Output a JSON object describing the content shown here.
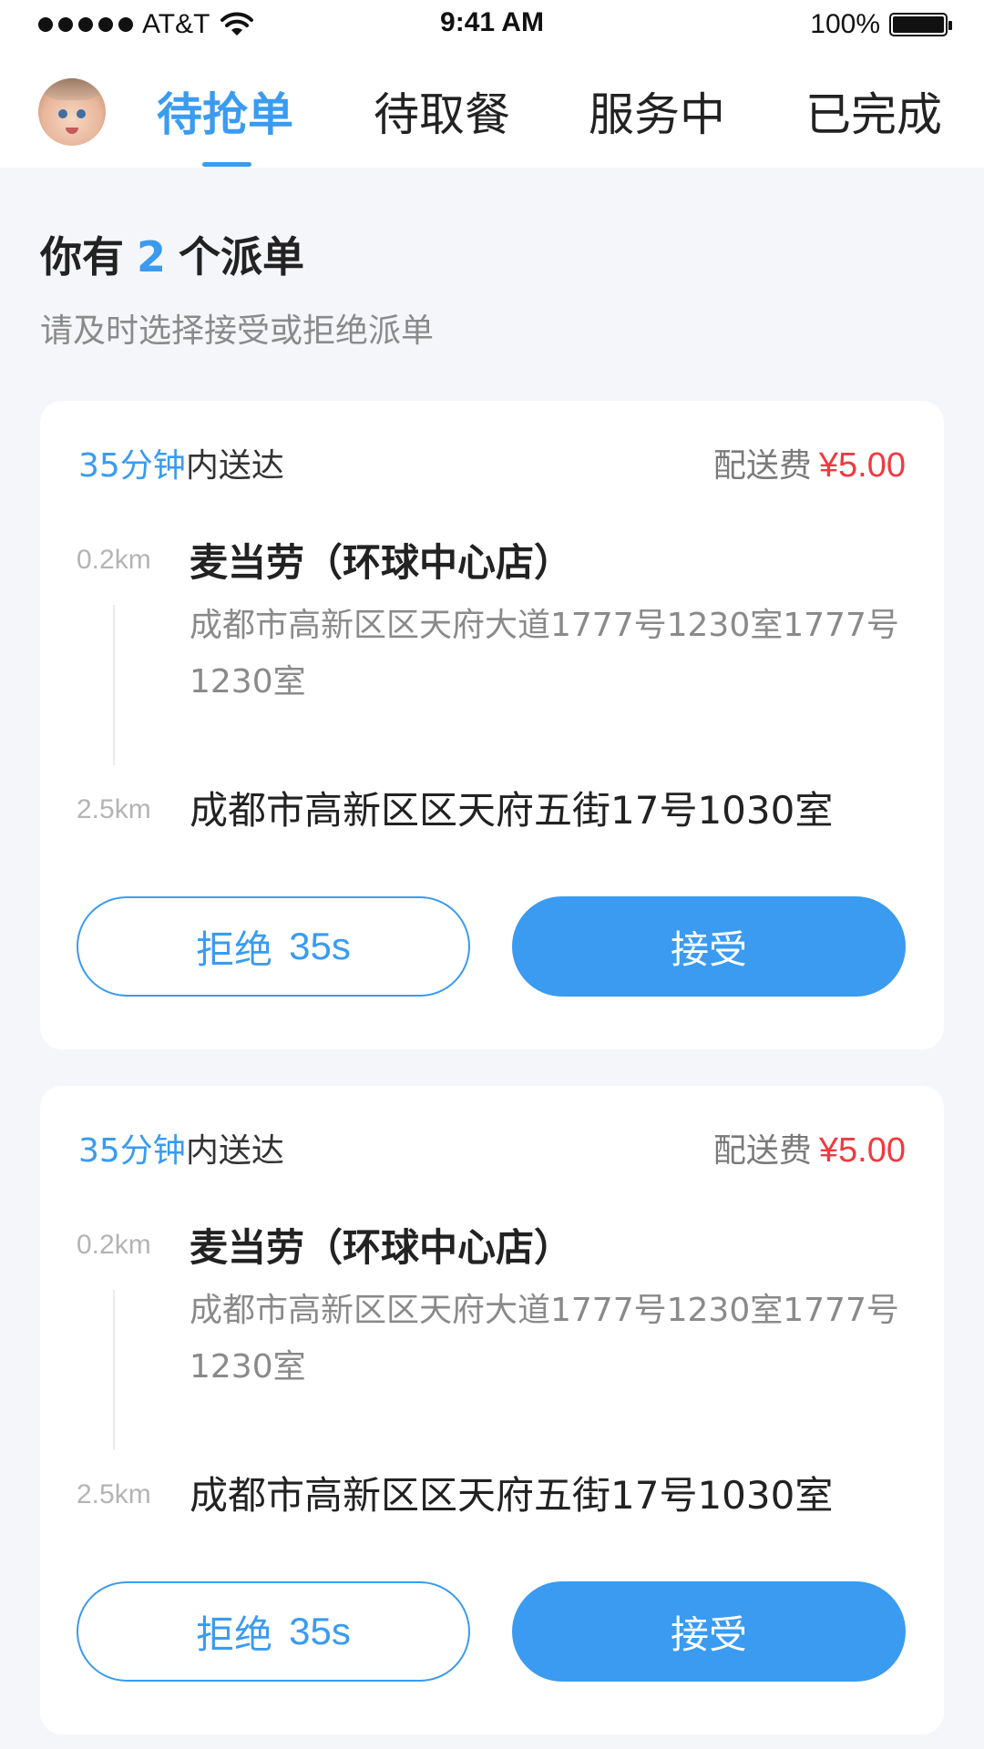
{
  "status_bar": {
    "carrier": "AT&T",
    "time": "9:41 AM",
    "battery": "100%"
  },
  "tabs": [
    {
      "label": "待抢单",
      "active": true
    },
    {
      "label": "待取餐",
      "active": false
    },
    {
      "label": "服务中",
      "active": false
    },
    {
      "label": "已完成",
      "active": false
    }
  ],
  "header": {
    "title_prefix": "你有",
    "count": "2",
    "title_suffix": "个派单",
    "subtitle": "请及时选择接受或拒绝派单"
  },
  "orders": [
    {
      "eta_time": "35分钟",
      "eta_suffix": "内送达",
      "fee_label": "配送费",
      "fee_amount": "¥5.00",
      "pickup_distance": "0.2km",
      "shop_name": "麦当劳（环球中心店）",
      "shop_address": "成都市高新区区天府大道1777号1230室1777号1230室",
      "dropoff_distance": "2.5km",
      "dropoff_address": "成都市高新区区天府五街17号1030室",
      "reject_label": "拒绝",
      "reject_countdown": "35s",
      "accept_label": "接受"
    },
    {
      "eta_time": "35分钟",
      "eta_suffix": "内送达",
      "fee_label": "配送费",
      "fee_amount": "¥5.00",
      "pickup_distance": "0.2km",
      "shop_name": "麦当劳（环球中心店）",
      "shop_address": "成都市高新区区天府大道1777号1230室1777号1230室",
      "dropoff_distance": "2.5km",
      "dropoff_address": "成都市高新区区天府五街17号1030室",
      "reject_label": "拒绝",
      "reject_countdown": "35s",
      "accept_label": "接受"
    }
  ],
  "colors": {
    "accent": "#3A9BF0",
    "price": "#F2393F",
    "background": "#F5F6FA"
  },
  "icons": [
    "signal-dots-icon",
    "wifi-icon",
    "battery-icon",
    "avatar"
  ]
}
